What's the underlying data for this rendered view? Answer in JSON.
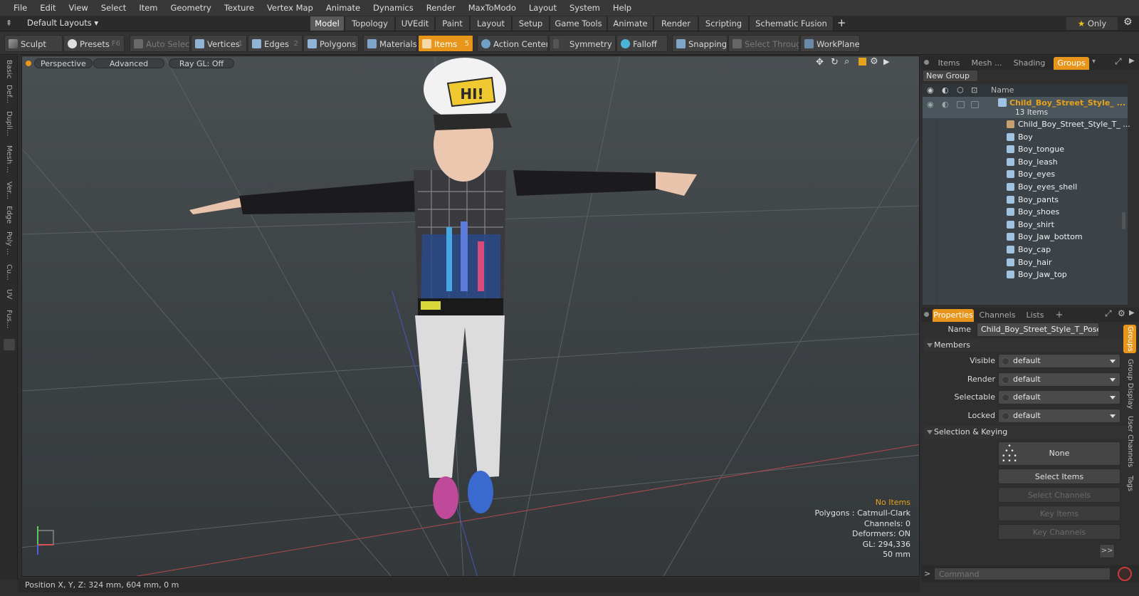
{
  "menubar": [
    "File",
    "Edit",
    "View",
    "Select",
    "Item",
    "Geometry",
    "Texture",
    "Vertex Map",
    "Animate",
    "Dynamics",
    "Render",
    "MaxToModo",
    "Layout",
    "System",
    "Help"
  ],
  "layouts": {
    "default_label": "Default Layouts",
    "only_label": "Only"
  },
  "layout_tabs": [
    "Model",
    "Topology",
    "UVEdit",
    "Paint",
    "Layout",
    "Setup",
    "Game Tools",
    "Animate",
    "Render",
    "Scripting",
    "Schematic Fusion"
  ],
  "toolbar": {
    "sculpt": "Sculpt",
    "presets": "Presets",
    "presets_key": "F6",
    "auto_select": "Auto Select",
    "vertices": "Vertices",
    "vertices_key": "1",
    "edges": "Edges",
    "edges_key": "2",
    "polygons": "Polygons",
    "materials": "Materials",
    "items": "Items",
    "items_key": "5",
    "action_center": "Action Center",
    "symmetry": "Symmetry",
    "falloff": "Falloff",
    "snapping": "Snapping",
    "select_through": "Select Through",
    "workplane": "WorkPlane"
  },
  "left_tabs": [
    "Basic",
    "Def...",
    "Dupli...",
    "Mesh ...",
    "Ver...",
    "Edge",
    "Poly ...",
    "Cu...",
    "UV",
    "Fus..."
  ],
  "viewport": {
    "view_label": "Perspective",
    "style_label": "Advanced",
    "raygl_label": "Ray GL: Off",
    "info": {
      "no_items": "No Items",
      "polygons": "Polygons : Catmull-Clark",
      "channels": "Channels: 0",
      "deformers": "Deformers: ON",
      "gl": "GL: 294,336",
      "scale": "50 mm"
    },
    "cap_text": "HI!"
  },
  "status": {
    "position": "Position X, Y, Z:  324 mm, 604 mm, 0 m"
  },
  "panel_tabs": {
    "items": "Items",
    "mesh": "Mesh ...",
    "shading": "Shading",
    "groups": "Groups"
  },
  "groups": {
    "new_group": "New Group",
    "name_header": "Name",
    "root_name": "Child_Boy_Street_Style_ ...",
    "root_count": "13 Items",
    "items": [
      "Child_Boy_Street_Style_T_ ...",
      "Boy",
      "Boy_tongue",
      "Boy_leash",
      "Boy_eyes",
      "Boy_eyes_shell",
      "Boy_pants",
      "Boy_shoes",
      "Boy_shirt",
      "Boy_Jaw_bottom",
      "Boy_cap",
      "Boy_hair",
      "Boy_Jaw_top"
    ]
  },
  "props_tabs": {
    "properties": "Properties",
    "channels": "Channels",
    "lists": "Lists",
    "add": "+"
  },
  "properties": {
    "name_label": "Name",
    "name_value": "Child_Boy_Street_Style_T_Pose (",
    "members_label": "Members",
    "fields": [
      {
        "label": "Visible",
        "value": "default"
      },
      {
        "label": "Render",
        "value": "default"
      },
      {
        "label": "Selectable",
        "value": "default"
      },
      {
        "label": "Locked",
        "value": "default"
      }
    ],
    "selkey_label": "Selection & Keying",
    "none_label": "None",
    "select_items": "Select Items",
    "select_channels": "Select Channels",
    "key_items": "Key Items",
    "key_channels": "Key Channels",
    "more": ">>"
  },
  "side_tabs": [
    "Groups",
    "Group Display",
    "User Channels",
    "Tags"
  ],
  "command": {
    "placeholder": "Command"
  },
  "colors": {
    "accent": "#e7961b",
    "viewport_top": "#4a4f52",
    "viewport_bottom": "#34383b"
  }
}
